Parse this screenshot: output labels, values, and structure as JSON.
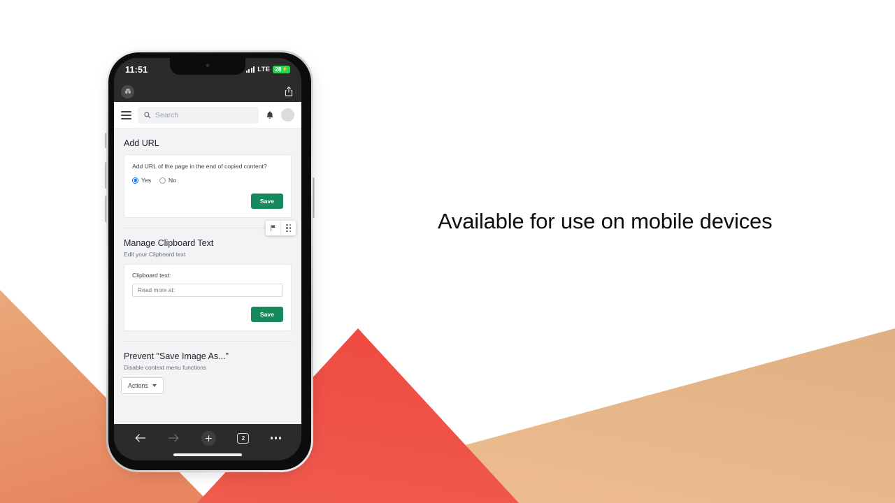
{
  "slide": {
    "headline": "Available for use on mobile devices",
    "background_colors": {
      "page": "#ffffff",
      "orange_triangle_top": "#e9a97c",
      "orange_triangle_bottom": "#e88b64",
      "red_triangle_top": "#ef4b44",
      "red_triangle_bottom": "#ef5a4e",
      "tan_shape_top": "#e0b183",
      "tan_shape_bottom": "#edbb8e"
    }
  },
  "phone": {
    "status_bar": {
      "time": "11:51",
      "signal_icon": "cellular-signal-icon",
      "network": "LTE",
      "battery_level": "28",
      "battery_charging_icon": "lightning-bolt-icon",
      "battery_color": "#30cf5b"
    },
    "browser_top": {
      "private_icon": "incognito-icon",
      "share_icon": "share-icon"
    },
    "browser_bottom": {
      "back_icon": "arrow-left-icon",
      "forward_icon": "arrow-right-icon",
      "new_tab_icon": "plus-icon",
      "tab_count": "2",
      "more_icon": "ellipsis-icon"
    }
  },
  "app": {
    "header": {
      "menu_icon": "hamburger-menu-icon",
      "search_icon": "search-icon",
      "search_placeholder": "Search",
      "search_value": "",
      "bell_icon": "notification-bell-icon",
      "avatar_icon": "user-avatar"
    },
    "sections": [
      {
        "title": "Add URL",
        "question": "Add URL of the page in the end of copied content?",
        "options": [
          {
            "label": "Yes",
            "selected": true
          },
          {
            "label": "No",
            "selected": false
          }
        ],
        "save_label": "Save",
        "save_color": "#168a5c"
      },
      {
        "title": "Manage Clipboard Text",
        "subtitle": "Edit your Clipboard text",
        "field_label": "Clipboard text:",
        "field_placeholder": "Read more at:",
        "field_value": "",
        "save_label": "Save",
        "save_color": "#168a5c"
      },
      {
        "title": "Prevent \"Save Image As...\"",
        "subtitle": "Disable context menu functions",
        "actions_label": "Actions",
        "actions_caret_icon": "chevron-down-icon"
      }
    ],
    "float_widget": {
      "flag_icon": "flag-icon",
      "drag_icon": "drag-grid-icon"
    }
  }
}
